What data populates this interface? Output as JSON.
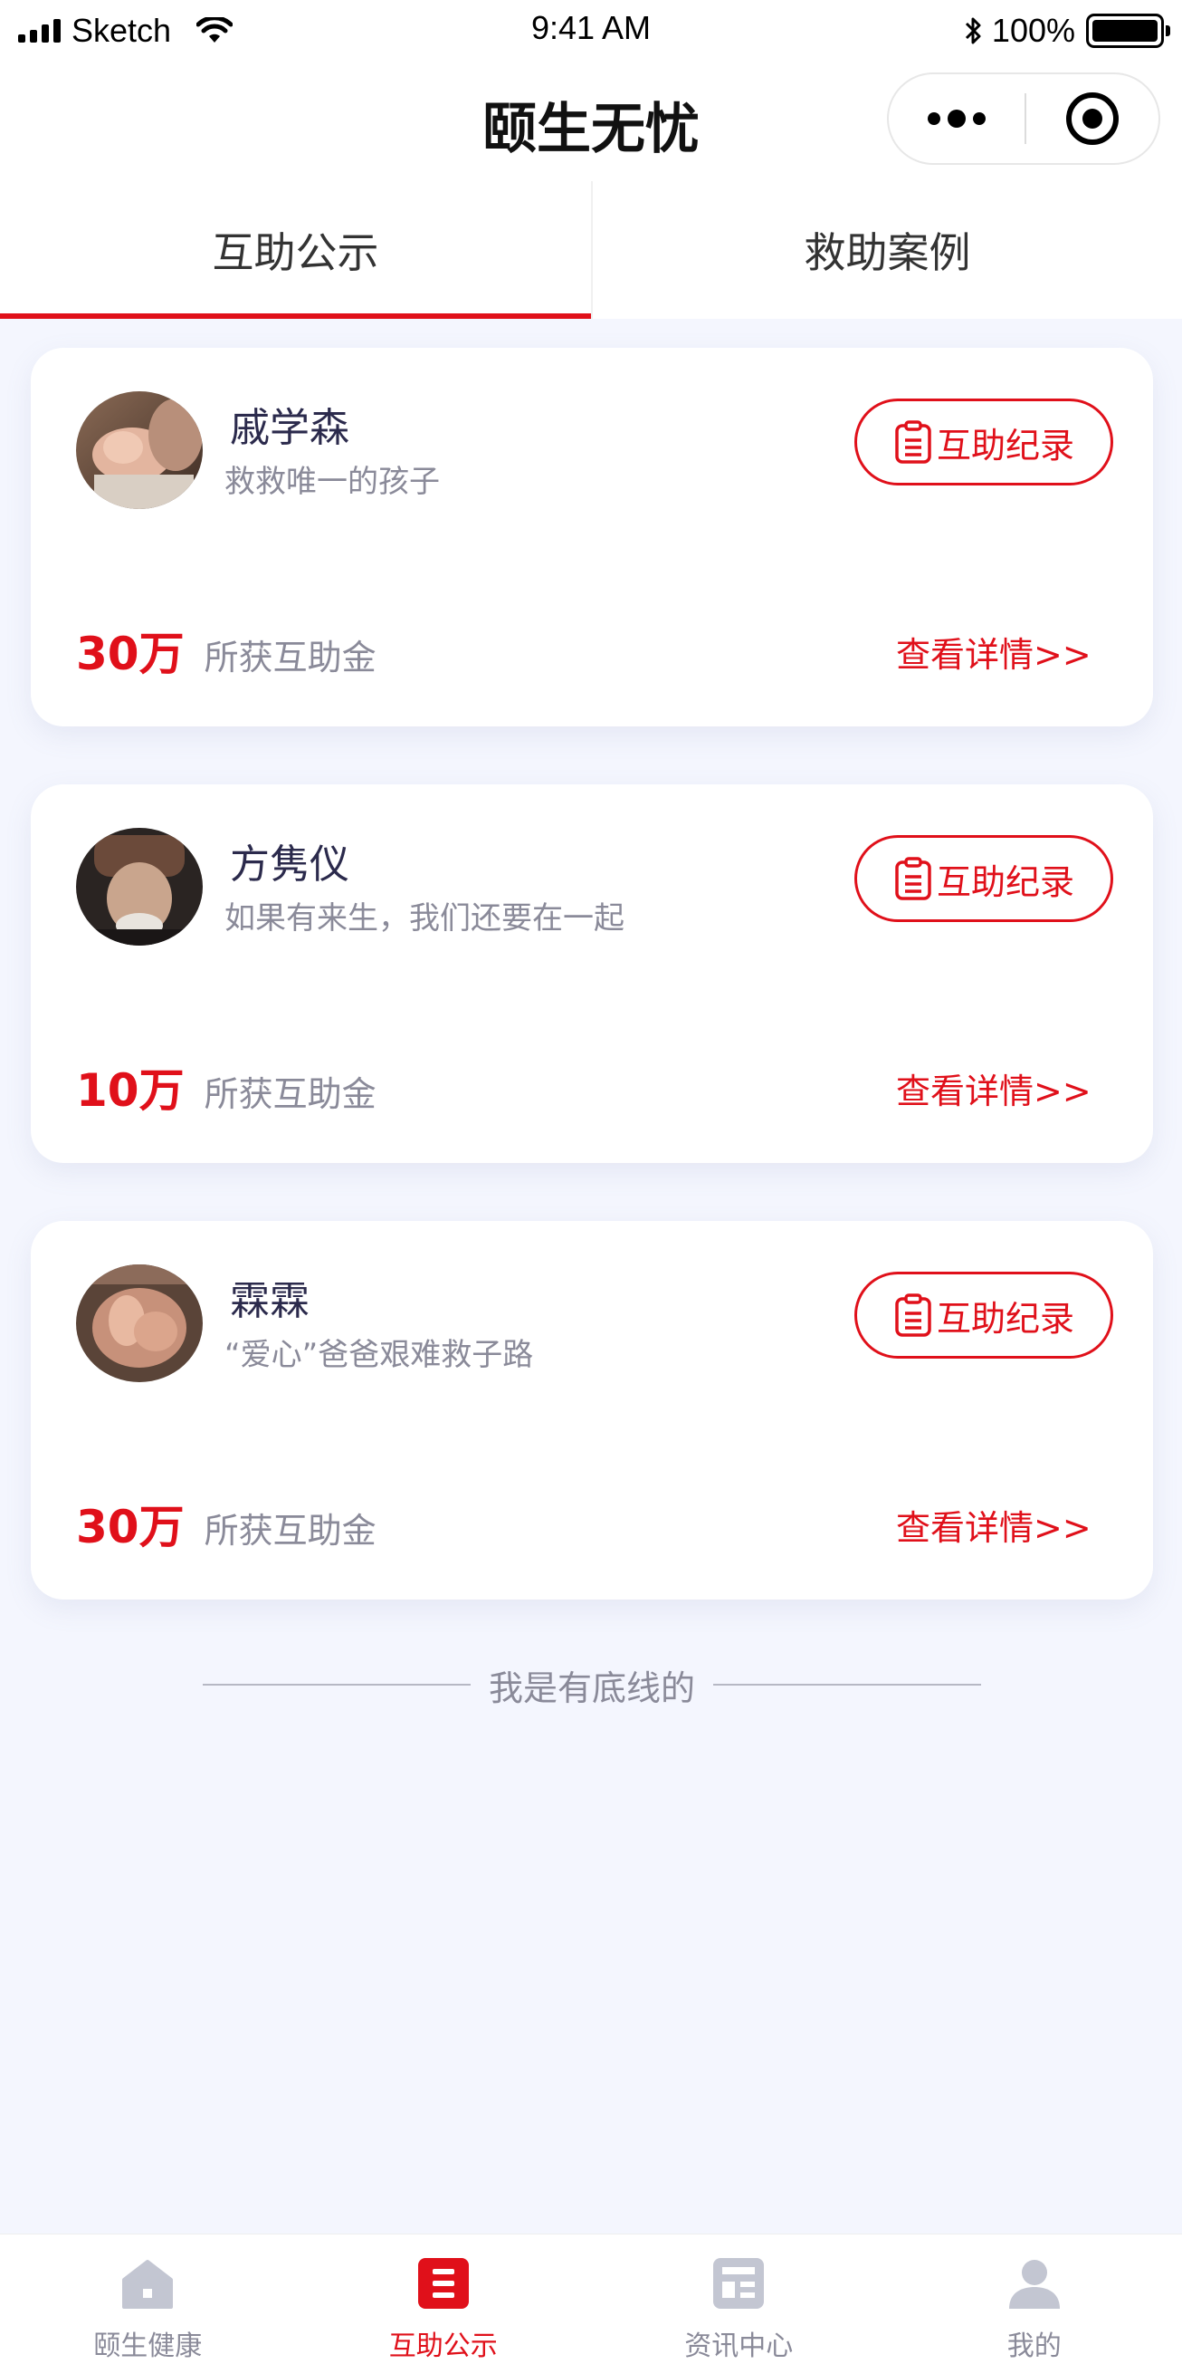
{
  "status_bar": {
    "carrier": "Sketch",
    "time": "9:41 AM",
    "battery": "100%"
  },
  "nav": {
    "title": "颐生无忧"
  },
  "tabs": [
    {
      "label": "互助公示",
      "active": true
    },
    {
      "label": "救助案例",
      "active": false
    }
  ],
  "cards": [
    {
      "name": "戚学森",
      "desc": "救救唯一的孩子",
      "record_label": "互助纪录",
      "amount": "30万",
      "amount_label": "所获互助金",
      "detail_label": "查看详情>>"
    },
    {
      "name": "方隽仪",
      "desc": "如果有来生，我们还要在一起",
      "record_label": "互助纪录",
      "amount": "10万",
      "amount_label": "所获互助金",
      "detail_label": "查看详情>>"
    },
    {
      "name": "霖霖",
      "desc": "“爱心”爸爸艰难救子路",
      "record_label": "互助纪录",
      "amount": "30万",
      "amount_label": "所获互助金",
      "detail_label": "查看详情>>"
    }
  ],
  "footer": {
    "text": "我是有底线的"
  },
  "tabbar": [
    {
      "label": "颐生健康",
      "icon": "home-icon",
      "active": false
    },
    {
      "label": "互助公示",
      "icon": "list-icon",
      "active": true
    },
    {
      "label": "资讯中心",
      "icon": "news-icon",
      "active": false
    },
    {
      "label": "我的",
      "icon": "user-icon",
      "active": false
    }
  ],
  "colors": {
    "accent": "#e0101a",
    "background": "#f4f6fe",
    "inactive": "#8a8a99"
  }
}
